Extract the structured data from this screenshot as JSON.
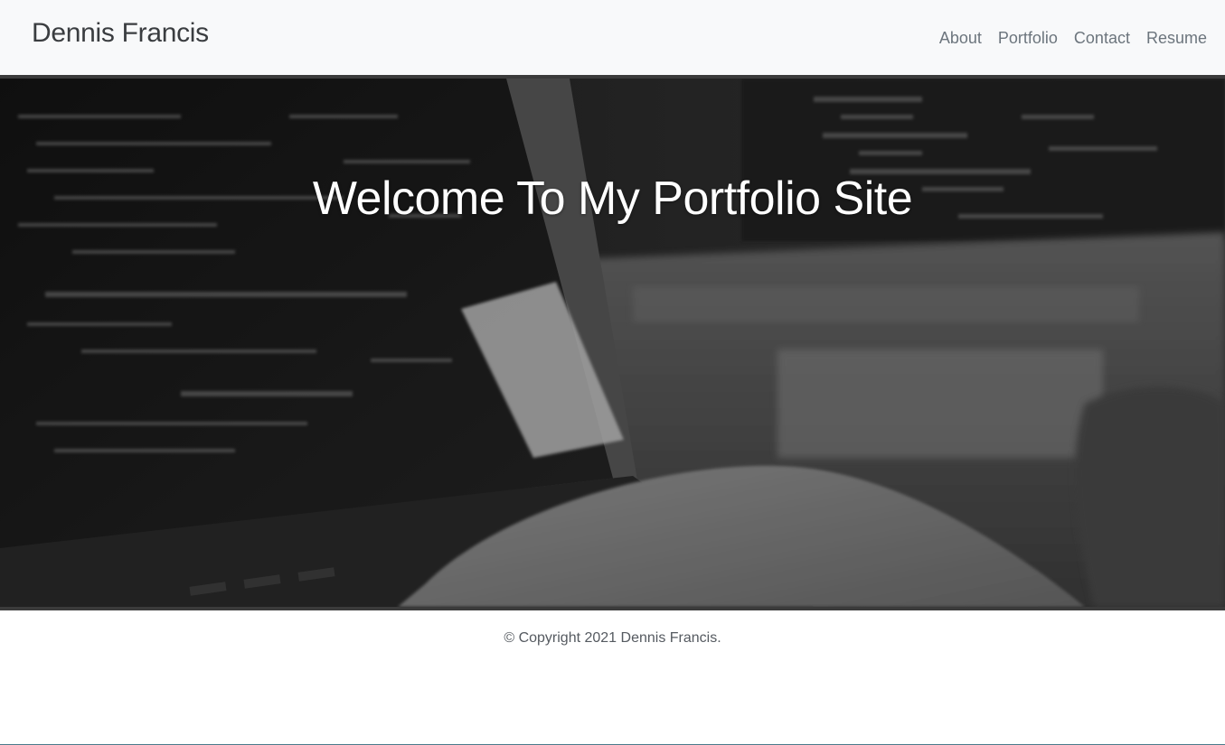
{
  "navbar": {
    "brand": "Dennis Francis",
    "links": [
      {
        "label": "About"
      },
      {
        "label": "Portfolio"
      },
      {
        "label": "Contact"
      },
      {
        "label": "Resume"
      }
    ]
  },
  "hero": {
    "title": "Welcome To My Portfolio Site"
  },
  "footer": {
    "copyright": "© Copyright 2021 Dennis Francis."
  },
  "colors": {
    "navbar_bg": "#f8f9fa",
    "brand_text": "#3a3d40",
    "nav_link": "#6c757d",
    "hero_text": "#ffffff",
    "footer_text": "#555a60"
  }
}
